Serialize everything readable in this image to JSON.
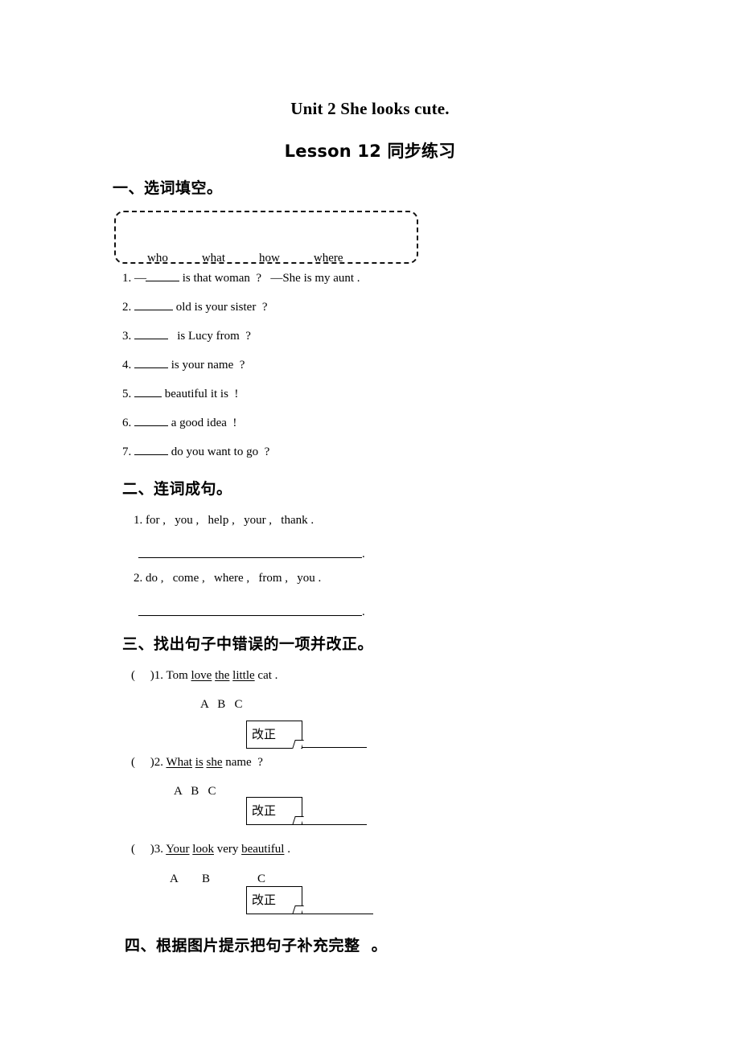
{
  "document": {
    "title_line_1": "Unit 2 She looks cute.",
    "title_line_2": "Lesson 12  同步练习"
  },
  "sections": [
    {
      "heading": "一、选词填空。",
      "word_bank": [
        "who",
        "what",
        "how",
        "where"
      ],
      "items": [
        {
          "number": "1.",
          "before": "—",
          "after": " is that woman  ?   —She is my aunt ."
        },
        {
          "number": "2.",
          "before": "",
          "after": " old is your sister  ?"
        },
        {
          "number": "3.",
          "before": "",
          "after": "   is Lucy from  ?"
        },
        {
          "number": "4.",
          "before": "",
          "after": " is your name  ?"
        },
        {
          "number": "5.",
          "before": "",
          "after": " beautiful it is  !"
        },
        {
          "number": "6.",
          "before": "",
          "after": " a good idea  !"
        },
        {
          "number": "7.",
          "before": "",
          "after": " do you want to go  ?"
        }
      ]
    },
    {
      "heading": "二、连词成句。",
      "items": [
        {
          "number": "1.",
          "text": "for ,   you ,   help ,   your ,   thank ."
        },
        {
          "number": "2.",
          "text": "do ,   come ,   where ,   from ,   you ."
        }
      ],
      "answer_end_mark": "."
    },
    {
      "heading": "三、找出句子中错误的一项并改正。",
      "bracket": "(     )",
      "fix_label": "改正",
      "items": [
        {
          "number": "1.",
          "parts": [
            {
              "text": " Tom ",
              "underline": false
            },
            {
              "text": "love",
              "underline": true
            },
            {
              "text": " ",
              "underline": false
            },
            {
              "text": "the",
              "underline": true
            },
            {
              "text": " ",
              "underline": false
            },
            {
              "text": "little",
              "underline": true
            },
            {
              "text": " cat .",
              "underline": false
            }
          ],
          "choices": "A   B   C"
        },
        {
          "number": "2.",
          "parts": [
            {
              "text": " ",
              "underline": false
            },
            {
              "text": "What",
              "underline": true
            },
            {
              "text": " ",
              "underline": false
            },
            {
              "text": "is",
              "underline": true
            },
            {
              "text": " ",
              "underline": false
            },
            {
              "text": "she",
              "underline": true
            },
            {
              "text": " name  ?",
              "underline": false
            }
          ],
          "choices": "A   B   C"
        },
        {
          "number": "3.",
          "parts": [
            {
              "text": " ",
              "underline": false
            },
            {
              "text": "Your",
              "underline": true
            },
            {
              "text": " ",
              "underline": false
            },
            {
              "text": "look",
              "underline": true
            },
            {
              "text": " very ",
              "underline": false
            },
            {
              "text": "beautiful",
              "underline": true
            },
            {
              "text": " .",
              "underline": false
            }
          ],
          "choices": "A        B",
          "choice_c": "C"
        }
      ]
    },
    {
      "heading": "四、根据图片提示把句子补充完整  。"
    }
  ]
}
